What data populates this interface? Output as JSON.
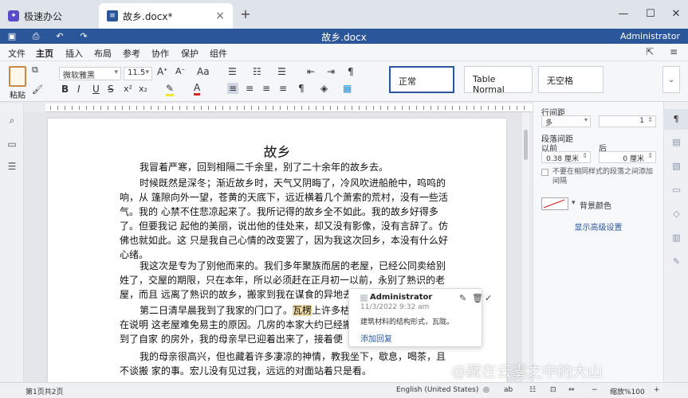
{
  "app": {
    "name": "极速办公",
    "tab_title": "故乡.docx*",
    "window_title": "故乡.docx",
    "user": "Administrator"
  },
  "menu": [
    "文件",
    "主页",
    "插入",
    "布局",
    "参考",
    "协作",
    "保护",
    "组件"
  ],
  "menu_active_index": 1,
  "ribbon": {
    "paste_label": "粘贴",
    "font_name": "微软雅黑",
    "font_size": "11.5",
    "styles": [
      "正常",
      "Table Normal",
      "无空格"
    ]
  },
  "document": {
    "title": "故乡",
    "paragraphs": [
      [
        "我冒着严寒，回到相隔二千余里，别了二十余年的故乡去。"
      ],
      [
        "时候既然是深冬；渐近故乡时，天气又阴晦了，冷风吹进船舱中，呜呜的",
        "响，从 篷隙向外一望，苍黄的天底下，远近横着几个萧索的荒村，没有一些活",
        "气。我的 心禁不住悲凉起来了。我所记得的故乡全不如此。我的故乡好得多",
        "了。但要我记 起他的美丽，说出他的佳处来，却又没有影像，没有言辞了。仿",
        "佛也就如此。这 只是我自己心情的改变罢了，因为我这次回乡，本没有什么好",
        "心绪。"
      ],
      [
        "我这次是专为了别他而来的。我们多年聚族而居的老屋，已经公同卖给别",
        "姓了，交屋的期限，只在本年，所以必须赶在正月初一以前，永别了熟识的老",
        "屋，而且 远离了熟识的故乡，搬家到我在谋食的异地去。"
      ],
      [
        "第二日清早晨我到了我家的门口了。瓦楞上许多枯",
        "在说明 这老屋难免易主的原因。几房的本家大约已经搬",
        "到了自家 的房外，我的母亲早已迎着出来了，接着便"
      ],
      [
        "我的母亲很高兴，但也藏着许多凄凉的神情，教我坐下，歇息，喝茶，且",
        "不谈搬 家的事。宏儿没有见过我，远远的对面站着只是看。"
      ]
    ],
    "highlight_word": "瓦楞"
  },
  "comment": {
    "author": "Administrator",
    "date": "11/3/2022 9:32 am",
    "text": "建筑材料的结构形式，瓦陇。",
    "reply_label": "添加回复"
  },
  "panel": {
    "line_spacing_label": "行间距",
    "line_spacing_mode": "多",
    "line_spacing_value": "1",
    "paragraph_spacing_label": "段落间距",
    "before_label": "以前",
    "after_label": "后",
    "before_value": "0.38 厘米",
    "after_value": "0 厘米",
    "no_space_same_style": "不要在相同样式的段落之间添加间隔",
    "background_color_label": "背景颜色",
    "advanced_settings": "显示高级设置"
  },
  "status": {
    "page": "第1页共2页",
    "language": "English (United States)",
    "zoom": "缩放%100"
  },
  "watermark": "@藏在云雾之中的大山",
  "colors": {
    "brand": "#2b579a",
    "highlight": "#f0dba6"
  }
}
